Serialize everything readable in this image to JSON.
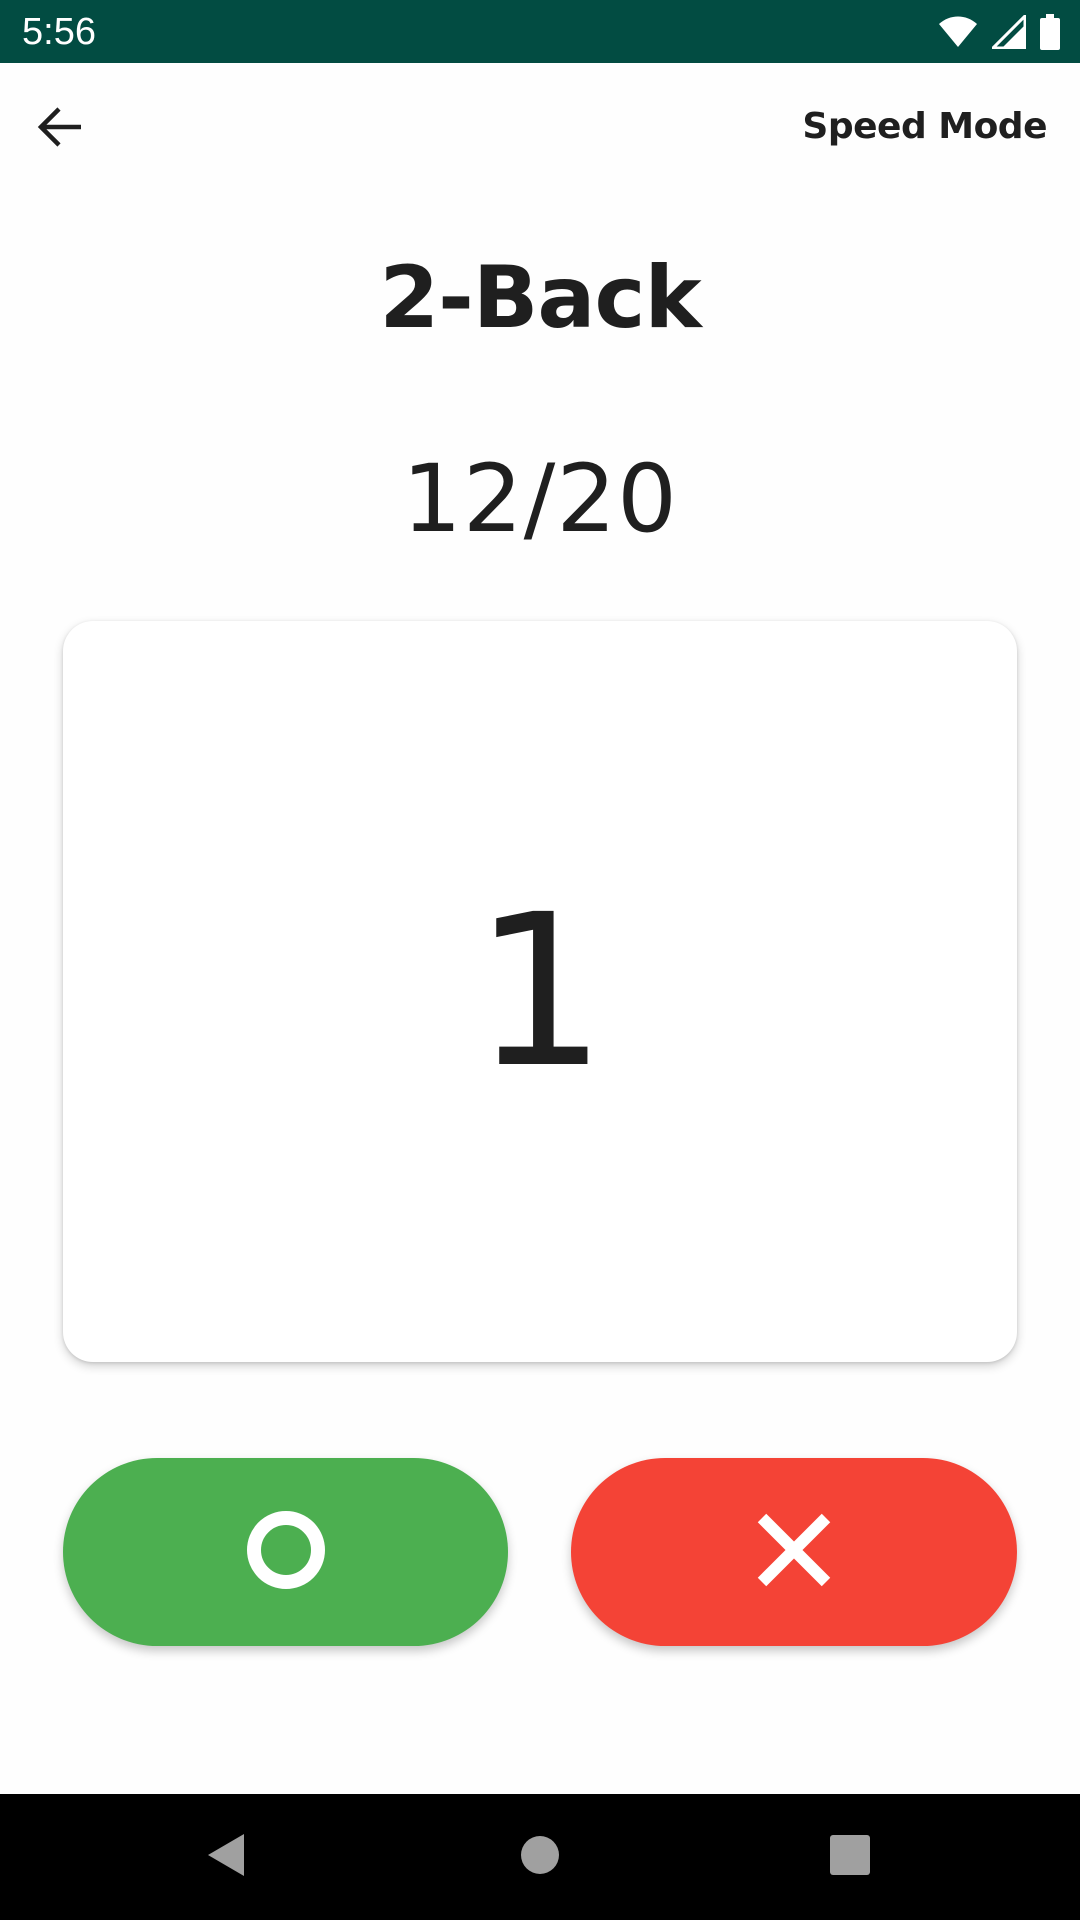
{
  "status_bar": {
    "time": "5:56",
    "icons": [
      "wifi-icon",
      "cellular-signal-icon",
      "battery-icon"
    ],
    "background": "#024c42"
  },
  "app_bar": {
    "back_icon": "arrow-left-icon",
    "mode_label": "Speed Mode"
  },
  "game": {
    "title": "2-Back",
    "progress": "12/20",
    "current_stimulus": "1"
  },
  "answers": {
    "match": {
      "icon": "circle-icon",
      "color": "#4caf50"
    },
    "no_match": {
      "icon": "cross-icon",
      "color": "#f44336"
    }
  },
  "nav_bar": {
    "icons": [
      "nav-back-icon",
      "nav-home-icon",
      "nav-recents-icon"
    ]
  }
}
